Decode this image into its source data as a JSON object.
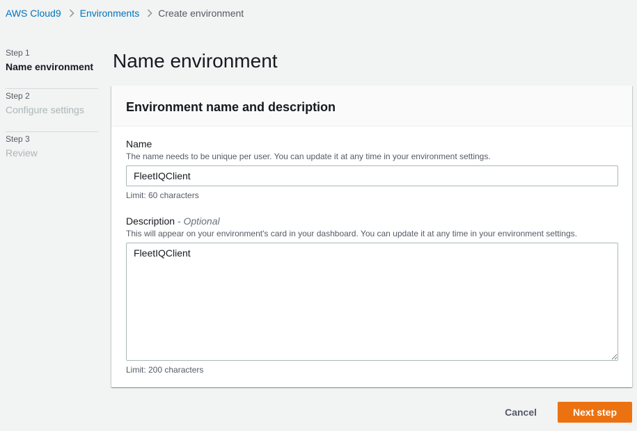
{
  "breadcrumb": {
    "items": [
      {
        "label": "AWS Cloud9"
      },
      {
        "label": "Environments"
      },
      {
        "label": "Create environment"
      }
    ]
  },
  "steps": [
    {
      "number": "Step 1",
      "title": "Name environment",
      "state": "active"
    },
    {
      "number": "Step 2",
      "title": "Configure settings",
      "state": "inactive"
    },
    {
      "number": "Step 3",
      "title": "Review",
      "state": "inactive"
    }
  ],
  "page": {
    "title": "Name environment"
  },
  "panel": {
    "title": "Environment name and description",
    "name_field": {
      "label": "Name",
      "description": "The name needs to be unique per user. You can update it at any time in your environment settings.",
      "value": "FleetIQClient",
      "hint": "Limit: 60 characters"
    },
    "description_field": {
      "label": "Description",
      "optional": "- Optional",
      "description": "This will appear on your environment's card in your dashboard. You can update it at any time in your environment settings.",
      "value": "FleetIQClient",
      "hint": "Limit: 200 characters"
    }
  },
  "actions": {
    "cancel_label": "Cancel",
    "next_label": "Next step"
  },
  "colors": {
    "link": "#0073bb",
    "primary": "#ec7211",
    "background": "#f2f3f3"
  },
  "icons": {
    "breadcrumb_separator": "chevron-right-icon"
  }
}
